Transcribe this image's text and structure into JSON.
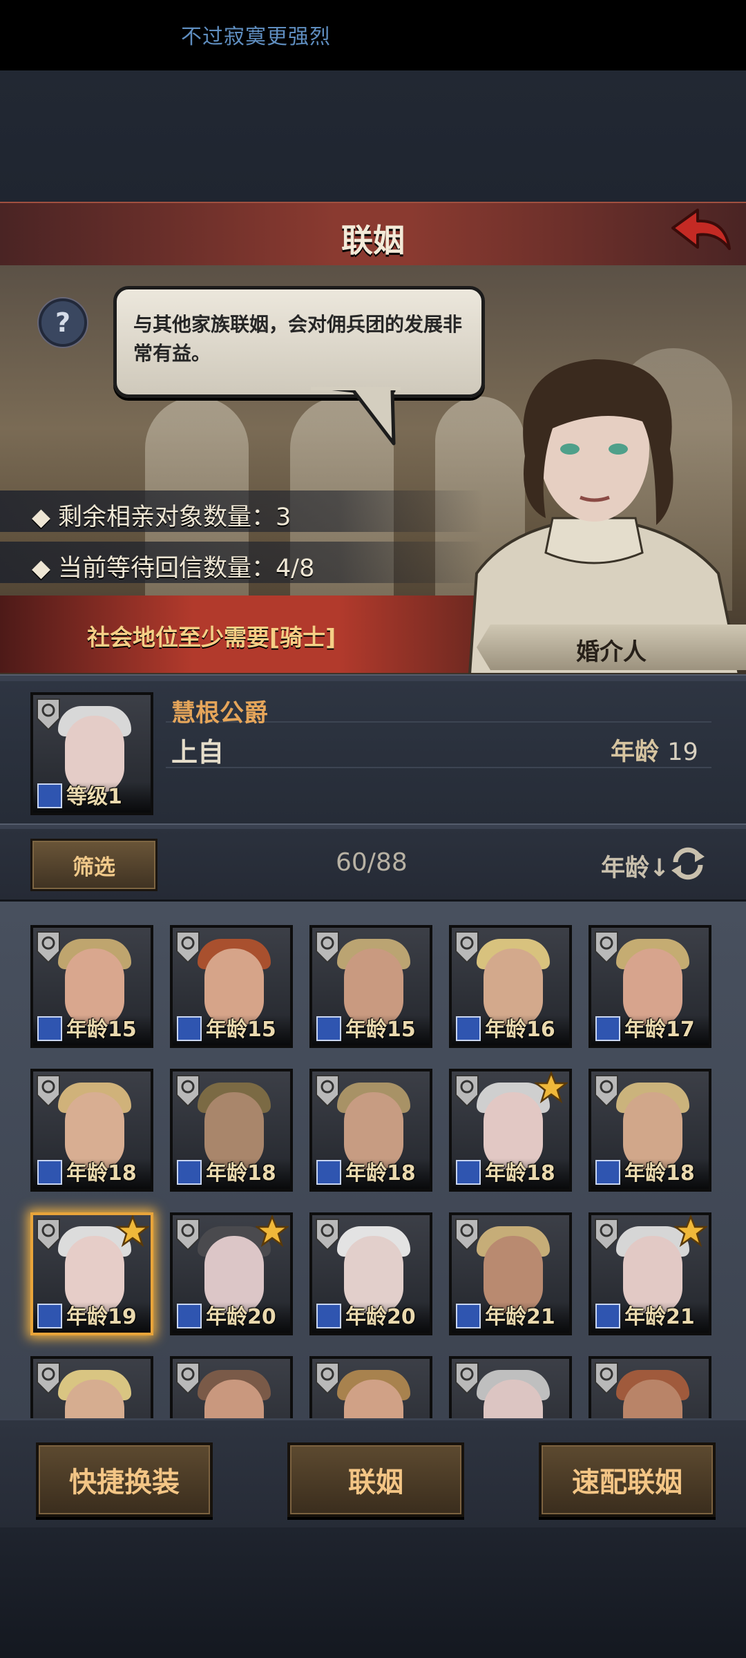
{
  "notification": "不过寂寞更强烈",
  "header": {
    "title": "联姻",
    "back_icon": "back-arrow-icon"
  },
  "dialog": {
    "text": "与其他家族联姻，会对佣兵团的发展非常有益。",
    "remaining_label": "◆ 剩余相亲对象数量：3",
    "waiting_label": "◆ 当前等待回信数量：4/8",
    "requirement": "社会地位至少需要[骑士]",
    "npc_name": "婚介人"
  },
  "selected": {
    "name": "慧根公爵",
    "status": "上自",
    "age_label": "年龄",
    "age_value": "19",
    "level": "等级1"
  },
  "filter": {
    "button": "筛选",
    "count": "60/88",
    "sort": "年龄↓"
  },
  "candidates": [
    {
      "age": "年龄15",
      "hair": "#bfa56e",
      "skin": "#d9a78e",
      "star": false
    },
    {
      "age": "年龄15",
      "hair": "#a9502e",
      "skin": "#d6a489",
      "star": false
    },
    {
      "age": "年龄15",
      "hair": "#bba472",
      "skin": "#c99a80",
      "star": false
    },
    {
      "age": "年龄16",
      "hair": "#d8c27e",
      "skin": "#d3a98c",
      "star": false
    },
    {
      "age": "年龄17",
      "hair": "#c5ac72",
      "skin": "#d7a48d",
      "star": false
    },
    {
      "age": "年龄18",
      "hair": "#d0b27a",
      "skin": "#d8ae92",
      "star": false
    },
    {
      "age": "年龄18",
      "hair": "#7b6a44",
      "skin": "#a9866b",
      "star": false
    },
    {
      "age": "年龄18",
      "hair": "#a89266",
      "skin": "#c79c82",
      "star": false
    },
    {
      "age": "年龄18",
      "hair": "#cfcfcf",
      "skin": "#e2c8c4",
      "star": true
    },
    {
      "age": "年龄18",
      "hair": "#cbb37c",
      "skin": "#d1a78a",
      "star": false
    },
    {
      "age": "年龄19",
      "hair": "#dcdcdc",
      "skin": "#e6cdc8",
      "star": true
    },
    {
      "age": "年龄20",
      "hair": "#4a4a4e",
      "skin": "#dcc6c7",
      "star": true
    },
    {
      "age": "年龄20",
      "hair": "#e3e3e3",
      "skin": "#e2cfcb",
      "star": false
    },
    {
      "age": "年龄21",
      "hair": "#c6ad78",
      "skin": "#b98a70",
      "star": false
    },
    {
      "age": "年龄21",
      "hair": "#d6d6d6",
      "skin": "#e2c9c5",
      "star": true
    },
    {
      "age": "",
      "hair": "#d9c582",
      "skin": "#d6ad90",
      "star": false
    },
    {
      "age": "",
      "hair": "#7a5a48",
      "skin": "#c9987e",
      "star": false
    },
    {
      "age": "",
      "hair": "#a8824e",
      "skin": "#d0a186",
      "star": false
    },
    {
      "age": "",
      "hair": "#bfbfbf",
      "skin": "#dcc5c2",
      "star": false
    },
    {
      "age": "",
      "hair": "#a05a3c",
      "skin": "#b98468",
      "star": false
    }
  ],
  "actions": {
    "quick_equip": "快捷换装",
    "marry": "联姻",
    "quick_match": "速配联姻"
  },
  "colors": {
    "title_red": "#8a3a30",
    "gold_text": "#f3c585",
    "select_glow": "#e8a43a"
  }
}
